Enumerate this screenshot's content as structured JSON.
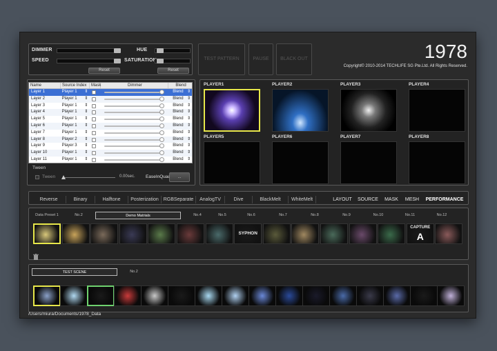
{
  "controls": {
    "dimmer_label": "DIMMER",
    "speed_label": "SPEED",
    "hue_label": "HUE",
    "saturation_label": "SATURATION",
    "reset_left": "Reset",
    "reset_right": "Reset"
  },
  "buttons": {
    "test_pattern": "TEST PATTERN",
    "pause": "PAUSE",
    "black_out": "BLACK OUT"
  },
  "brand": {
    "logo": "1978",
    "copyright": "Copyright© 2010-2014 TECHLIFE SG Pte.Ltd. All Rights Reserved."
  },
  "layers": {
    "headers": [
      "Name",
      "Source Index",
      "Mask",
      "Dimmer",
      "Blend"
    ],
    "rows": [
      {
        "name": "Layer 1",
        "source": "Player 1",
        "blend": "Blend"
      },
      {
        "name": "Layer 2",
        "source": "Player 1",
        "blend": "Blend"
      },
      {
        "name": "Layer 3",
        "source": "Player 1",
        "blend": "Blend"
      },
      {
        "name": "Layer 4",
        "source": "Player 1",
        "blend": "Blend"
      },
      {
        "name": "Layer 5",
        "source": "Player 1",
        "blend": "Blend"
      },
      {
        "name": "Layer 6",
        "source": "Player 1",
        "blend": "Blend"
      },
      {
        "name": "Layer 7",
        "source": "Player 1",
        "blend": "Blend"
      },
      {
        "name": "Layer 8",
        "source": "Player 2",
        "blend": "Blend"
      },
      {
        "name": "Layer 9",
        "source": "Player 3",
        "blend": "Blend"
      },
      {
        "name": "Layer 10",
        "source": "Player 1",
        "blend": "Blend"
      },
      {
        "name": "Layer 11",
        "source": "Player 1",
        "blend": "Blend"
      }
    ]
  },
  "tween": {
    "title": "Tween",
    "checkbox_label": "Tween",
    "seconds": "0.00sec.",
    "easing": "EaseInQuad",
    "more_button": "..."
  },
  "players": [
    "PLAYER1",
    "PLAYER2",
    "PLAYER3",
    "PLAYER4",
    "PLAYER5",
    "PLAYER6",
    "PLAYER7",
    "PLAYER8"
  ],
  "effects": [
    "Reverse",
    "Binary",
    "Halftone",
    "Posterization",
    "RGBSeparate",
    "AnalogTV",
    "Dive",
    "BlackMelt",
    "WhiteMelt"
  ],
  "modes": [
    "LAYOUT",
    "SOURCE",
    "MASK",
    "MESH",
    "PERFORMANCE"
  ],
  "active_mode": "PERFORMANCE",
  "presets": [
    "Data Preset 1",
    "No.2",
    "Demo Matrials",
    "No.4",
    "No.5",
    "No.6",
    "No.7",
    "No.8",
    "No.9",
    "No.10",
    "No.11",
    "No.12"
  ],
  "thumb_labels": {
    "syphon": "SYPHON",
    "capture": "CAPTURE",
    "capture_letter": "A"
  },
  "scenes": [
    "TEST SCENE",
    "No.2"
  ],
  "path": "/Users/miura/Documents/1978_Data",
  "colors": {
    "accent_yellow": "#e8e84a",
    "selection_blue": "#3b6fd4",
    "accent_green": "#6fd36f"
  }
}
